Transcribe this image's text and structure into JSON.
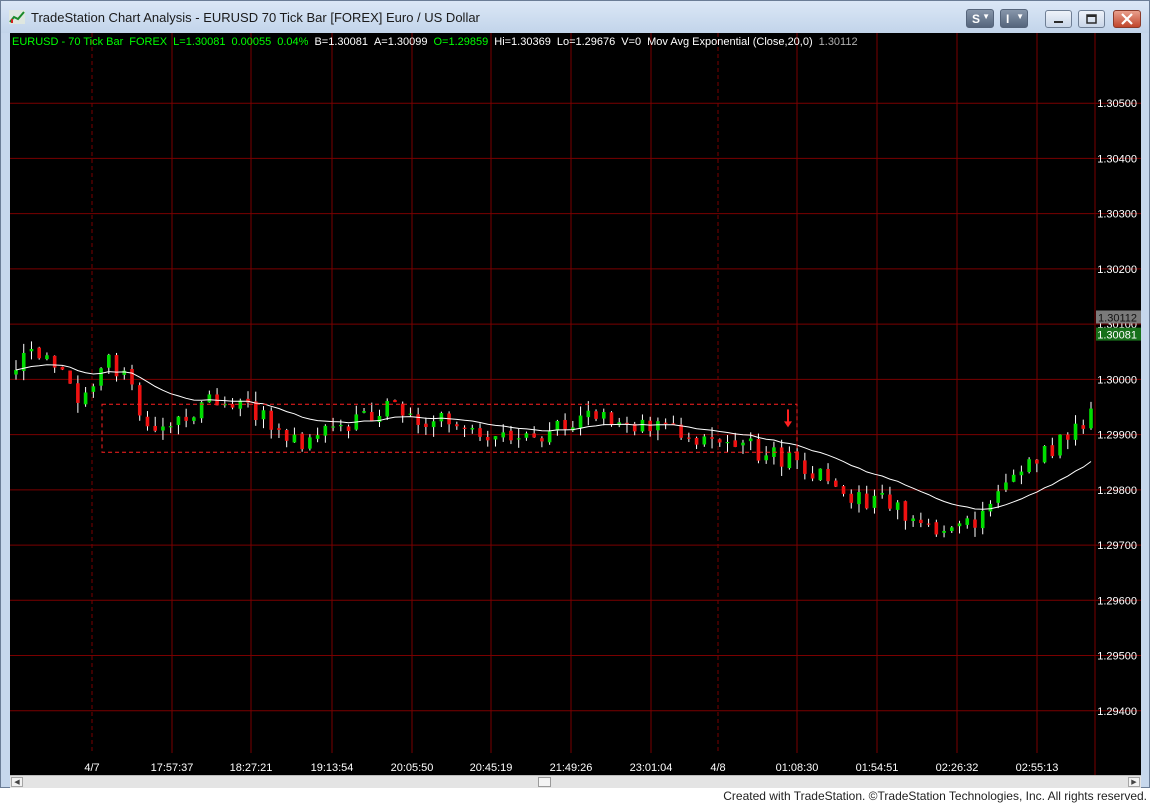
{
  "window": {
    "title": "TradeStation Chart Analysis - EURUSD 70 Tick Bar [FOREX] Euro / US Dollar",
    "toolbar": [
      {
        "label": "S",
        "icon": "dropdown-arrow-icon"
      },
      {
        "label": "I",
        "icon": "dropdown-arrow-icon"
      }
    ],
    "controls": [
      "minimize-icon",
      "restore-icon",
      "close-icon"
    ]
  },
  "status_line": [
    {
      "text": "EURUSD - 70 Tick Bar",
      "color": "#00ff00"
    },
    {
      "text": "FOREX",
      "color": "#00ff00"
    },
    {
      "text": "L=1.30081",
      "color": "#00ff00"
    },
    {
      "text": "0.00055",
      "color": "#00ff00"
    },
    {
      "text": "0.04%",
      "color": "#00ff00"
    },
    {
      "text": "B=1.30081",
      "color": "#ffffff"
    },
    {
      "text": "A=1.30099",
      "color": "#ffffff"
    },
    {
      "text": "O=1.29859",
      "color": "#00ff00"
    },
    {
      "text": "Hi=1.30369",
      "color": "#ffffff"
    },
    {
      "text": "Lo=1.29676",
      "color": "#ffffff"
    },
    {
      "text": "V=0",
      "color": "#ffffff"
    },
    {
      "text": "Mov Avg Exponential (Close,20,0)",
      "color": "#ffffff"
    },
    {
      "text": "1.30112",
      "color": "#b0b0b0"
    }
  ],
  "chart_data": {
    "type": "candlestick",
    "symbol": "EURUSD",
    "interval": "70 Tick Bar",
    "y_axis": {
      "min": 1.293,
      "max": 1.3058,
      "ticks": [
        "1.30500",
        "1.30400",
        "1.30300",
        "1.30200",
        "1.30100",
        "1.30000",
        "1.29900",
        "1.29800",
        "1.29700",
        "1.29600",
        "1.29500",
        "1.29400"
      ]
    },
    "x_axis": {
      "ticks": [
        "4/7",
        "17:57:37",
        "18:27:21",
        "19:13:54",
        "20:05:50",
        "20:45:19",
        "21:49:26",
        "23:01:04",
        "4/8",
        "01:08:30",
        "01:54:51",
        "02:26:32",
        "02:55:13"
      ],
      "date_separators": [
        "4/7",
        "4/8"
      ]
    },
    "price_markers": [
      {
        "label": "1.30112",
        "value": 1.30112,
        "color": "#7a7a7a",
        "text_color": "#111111"
      },
      {
        "label": "1.30081",
        "value": 1.30081,
        "color": "#17701a",
        "text_color": "#ffffff"
      }
    ],
    "bar_count": 140,
    "first_open": 1.3001,
    "close_path": [
      [
        0,
        1.3003
      ],
      [
        4,
        1.3006
      ],
      [
        8,
        1.2996
      ],
      [
        12,
        1.3003
      ],
      [
        14,
        1.3001
      ],
      [
        17,
        1.299
      ],
      [
        21,
        1.2992
      ],
      [
        25,
        1.2996
      ],
      [
        29,
        1.2995
      ],
      [
        33,
        1.2992
      ],
      [
        37,
        1.2989
      ],
      [
        41,
        1.2991
      ],
      [
        45,
        1.29925
      ],
      [
        48,
        1.29955
      ],
      [
        52,
        1.2993
      ],
      [
        56,
        1.2992
      ],
      [
        60,
        1.2991
      ],
      [
        64,
        1.2989
      ],
      [
        68,
        1.299
      ],
      [
        72,
        1.29925
      ],
      [
        76,
        1.2993
      ],
      [
        80,
        1.2992
      ],
      [
        84,
        1.29905
      ],
      [
        88,
        1.299
      ],
      [
        92,
        1.2989
      ],
      [
        96,
        1.2987
      ],
      [
        100,
        1.2985
      ],
      [
        104,
        1.2982
      ],
      [
        108,
        1.2979
      ],
      [
        112,
        1.2978
      ],
      [
        116,
        1.2975
      ],
      [
        120,
        1.2972
      ],
      [
        124,
        1.2974
      ],
      [
        128,
        1.2982
      ],
      [
        132,
        1.2985
      ],
      [
        136,
        1.299
      ],
      [
        140,
        1.2995
      ]
    ],
    "indicator": {
      "name": "Mov Avg Exponential (Close,20,0)",
      "length": 20,
      "color": "#ffffff"
    },
    "consolidation_box": {
      "x_start": "4/7",
      "x_end": "01:08:30",
      "high": 1.29955,
      "low": 1.29868,
      "color": "#ff2020",
      "style": "dashed"
    },
    "arrow_marker": {
      "x": "01:08:30",
      "value": 1.29913,
      "direction": "down",
      "color": "#ff2020"
    },
    "colors": {
      "background": "#000000",
      "grid": "#7a0000",
      "up": "#00dd00",
      "down": "#ee1111",
      "wick": "#ffffff",
      "axis_text": "#ffffff"
    },
    "grid": true
  },
  "footer": "Created with TradeStation. ©TradeStation Technologies, Inc. All rights reserved."
}
